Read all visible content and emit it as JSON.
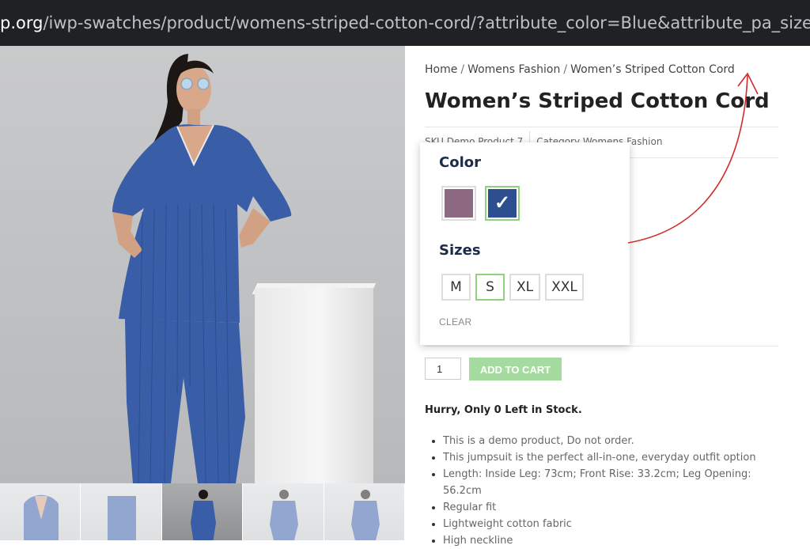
{
  "url": {
    "domain": "p.org",
    "path": "/iwp-swatches/product/womens-striped-cotton-cord/?attribute_color=Blue&attribute_pa_sizes=s"
  },
  "breadcrumb": {
    "items": [
      "Home",
      "Womens Fashion",
      "Women’s Striped Cotton Cord"
    ],
    "separator": "/"
  },
  "product": {
    "title": "Women’s Striped Cotton Cord",
    "sku": "SKU Demo Product 7",
    "category": "Category Womens Fashion"
  },
  "variations": {
    "color_label": "Color",
    "colors": [
      {
        "name": "Mauve",
        "hex": "#8e6a82",
        "selected": false
      },
      {
        "name": "Blue",
        "hex": "#2e4f8f",
        "selected": true
      }
    ],
    "sizes_label": "Sizes",
    "sizes": [
      {
        "label": "M",
        "selected": false
      },
      {
        "label": "S",
        "selected": true
      },
      {
        "label": "XL",
        "selected": false
      },
      {
        "label": "XXL",
        "selected": false
      }
    ],
    "clear_label": "CLEAR"
  },
  "cart": {
    "quantity": "1",
    "add_to_cart_label": "ADD TO CART"
  },
  "stock_message": "Hurry, Only 0 Left in Stock.",
  "features": [
    "This is a demo product, Do not order.",
    "This jumpsuit is the perfect all-in-one, everyday outfit option",
    "Length: Inside Leg: 73cm; Front Rise: 33.2cm; Leg Opening: 56.2cm",
    "Regular fit",
    "Lightweight cotton fabric",
    "High neckline"
  ],
  "colors": {
    "accent_selected": "#8fd27e",
    "add_to_cart_bg": "#a6dba0",
    "annotation_arrow": "#d22a2a",
    "garment_blue": "#3a5da8"
  }
}
